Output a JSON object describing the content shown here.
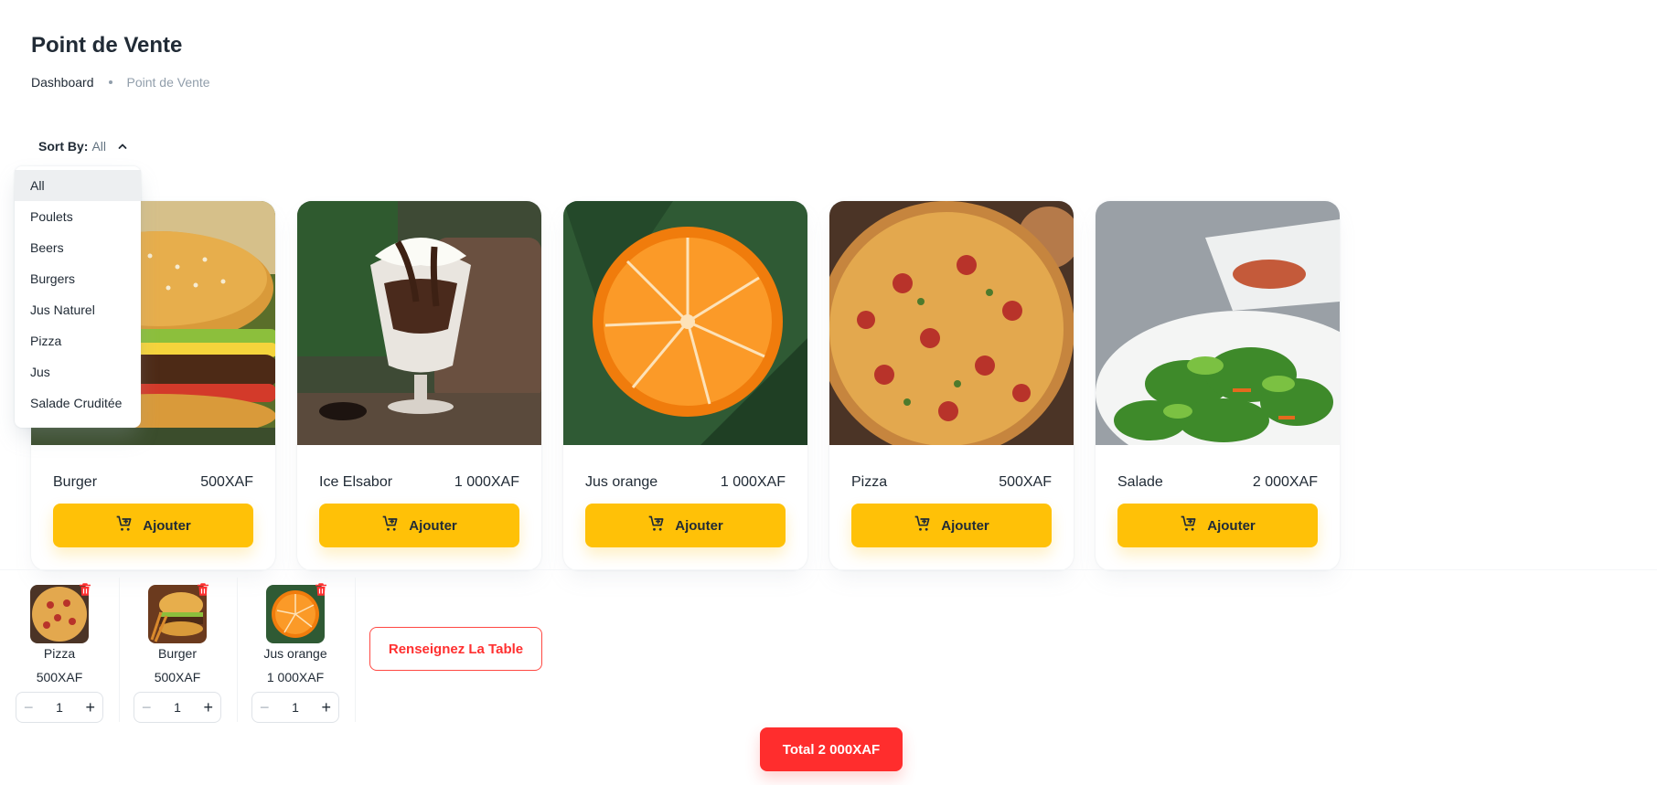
{
  "page": {
    "title": "Point de Vente"
  },
  "breadcrumb": {
    "items": [
      "Dashboard",
      "Point de Vente"
    ]
  },
  "sort": {
    "label": "Sort By:",
    "value": "All",
    "options": [
      "All",
      "Poulets",
      "Beers",
      "Burgers",
      "Jus Naturel",
      "Pizza",
      "Jus",
      "Salade Cruditée"
    ]
  },
  "products": [
    {
      "name": "Burger",
      "price": "500XAF",
      "button": "Ajouter"
    },
    {
      "name": "Ice Elsabor",
      "price": "1 000XAF",
      "button": "Ajouter"
    },
    {
      "name": "Jus orange",
      "price": "1 000XAF",
      "button": "Ajouter"
    },
    {
      "name": "Pizza",
      "price": "500XAF",
      "button": "Ajouter"
    },
    {
      "name": "Salade",
      "price": "2 000XAF",
      "button": "Ajouter"
    }
  ],
  "cart": {
    "items": [
      {
        "name": "Pizza",
        "price": "500XAF",
        "qty": "1"
      },
      {
        "name": "Burger",
        "price": "500XAF",
        "qty": "1"
      },
      {
        "name": "Jus orange",
        "price": "1 000XAF",
        "qty": "1"
      }
    ],
    "table_button": "Renseignez La Table",
    "total_button": "Total 2 000XAF"
  },
  "colors": {
    "accent": "#ffc107",
    "danger": "#ff2d2d",
    "text": "#212b36",
    "muted": "#919eab"
  },
  "icons": {
    "cart_add": "cart-plus-icon",
    "delete": "trash-icon",
    "sort_chevron": "chevron-up-icon"
  }
}
